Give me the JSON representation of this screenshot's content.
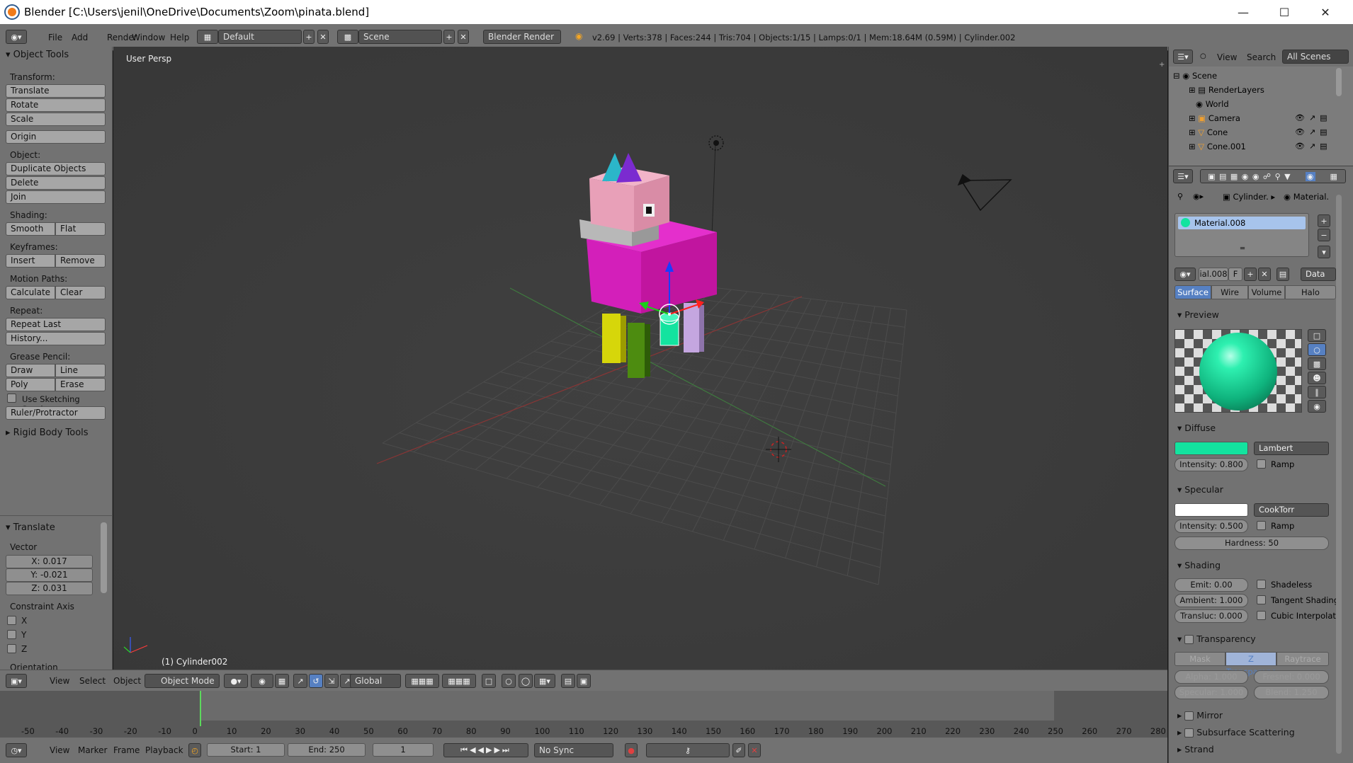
{
  "window": {
    "title": "Blender [C:\\Users\\jenil\\OneDrive\\Documents\\Zoom\\pinata.blend]"
  },
  "info_header": {
    "menus": [
      "File",
      "Add",
      "Render",
      "Window",
      "Help"
    ],
    "screen_layout": "Default",
    "scene": "Scene",
    "render_engine": "Blender Render",
    "stats": "v2.69 | Verts:378 | Faces:244 | Tris:704 | Objects:1/15 | Lamps:0/1 | Mem:18.64M (0.59M) | Cylinder.002"
  },
  "tool_shelf": {
    "title": "Object Tools",
    "transform_label": "Transform:",
    "translate": "Translate",
    "rotate": "Rotate",
    "scale": "Scale",
    "origin": "Origin",
    "object_label": "Object:",
    "duplicate": "Duplicate Objects",
    "delete": "Delete",
    "join": "Join",
    "shading_label": "Shading:",
    "smooth": "Smooth",
    "flat": "Flat",
    "keyframes_label": "Keyframes:",
    "insert": "Insert",
    "remove": "Remove",
    "motion_label": "Motion Paths:",
    "calculate": "Calculate",
    "clear": "Clear",
    "repeat_label": "Repeat:",
    "repeat_last": "Repeat Last",
    "history": "History...",
    "grease_label": "Grease Pencil:",
    "draw": "Draw",
    "line": "Line",
    "poly": "Poly",
    "erase": "Erase",
    "sketching": "Use Sketching Sessions",
    "ruler": "Ruler/Protractor",
    "rigid": "Rigid Body Tools"
  },
  "operator_panel": {
    "title": "Translate",
    "vector_label": "Vector",
    "x": "X: 0.017",
    "y": "Y: -0.021",
    "z": "Z: 0.031",
    "constraint_label": "Constraint Axis",
    "cx": "X",
    "cy": "Y",
    "cz": "Z",
    "orientation": "Orientation"
  },
  "viewport": {
    "view_name": "User Persp",
    "object_label": "(1) Cylinder002"
  },
  "viewport_header": {
    "view": "View",
    "select": "Select",
    "object": "Object",
    "mode": "Object Mode",
    "orientation": "Global"
  },
  "timeline": {
    "ticks": [
      "-50",
      "-40",
      "-30",
      "-20",
      "-10",
      "0",
      "10",
      "20",
      "30",
      "40",
      "50",
      "60",
      "70",
      "80",
      "90",
      "100",
      "110",
      "120",
      "130",
      "140",
      "150",
      "160",
      "170",
      "180",
      "190",
      "200",
      "210",
      "220",
      "230",
      "240",
      "250",
      "260",
      "270",
      "280"
    ],
    "view": "View",
    "marker": "Marker",
    "frame": "Frame",
    "playback": "Playback",
    "start": "Start: 1",
    "end": "End: 250",
    "current": "1",
    "sync": "No Sync"
  },
  "outliner": {
    "view": "View",
    "search": "Search",
    "filter": "All Scenes",
    "items": [
      "Scene",
      "RenderLayers",
      "World",
      "Camera",
      "Cone",
      "Cone.001"
    ]
  },
  "properties": {
    "crumb_object": "Cylinder.",
    "crumb_material": "Material.",
    "material_slot": "Material.008",
    "mat_name": "ial.008",
    "mat_f": "F",
    "data": "Data",
    "tabs": [
      "Surface",
      "Wire",
      "Volume",
      "Halo"
    ],
    "preview": "Preview",
    "diffuse": "Diffuse",
    "diffuse_shader": "Lambert",
    "diffuse_intensity": "Intensity: 0.800",
    "ramp": "Ramp",
    "specular": "Specular",
    "spec_shader": "CookTorr",
    "spec_intensity": "Intensity: 0.500",
    "hardness": "Hardness: 50",
    "shading": "Shading",
    "emit": "Emit: 0.00",
    "ambient": "Ambient: 1.000",
    "transluc": "Transluc: 0.000",
    "shadeless": "Shadeless",
    "tangent": "Tangent Shading",
    "cubic": "Cubic Interpolati",
    "transparency": "Transparency",
    "mask": "Mask",
    "ztrans": "Z Transparenc",
    "raytrace": "Raytrace",
    "alpha": "Alpha: 1.000",
    "fresnel": "Fresnel: 0.000",
    "spec_t": "Specular: 1.000",
    "blend": "Blend: 1.250",
    "mirror": "Mirror",
    "sss": "Subsurface Scattering",
    "strand": "Strand"
  },
  "colors": {
    "diffuse": "#13e39f",
    "specular": "#ffffff",
    "accent": "#5680c2"
  }
}
